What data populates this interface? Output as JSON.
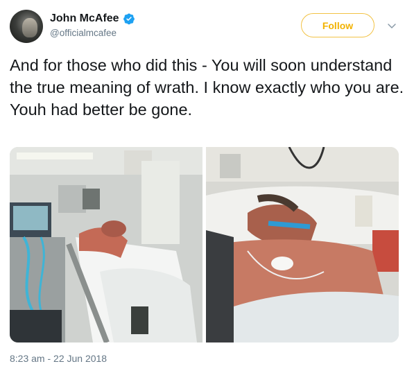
{
  "tweet": {
    "author": {
      "display_name": "John McAfee",
      "handle": "@officialmcafee",
      "verified": true,
      "avatar_icon": "avatar-photo"
    },
    "follow_label": "Follow",
    "text": "And for those who did this - You will soon understand the true meaning of wrath. I know exactly who you  are. Youh had better be gone.",
    "media": [
      {
        "kind": "photo",
        "subject": "hospital-bed-left"
      },
      {
        "kind": "photo",
        "subject": "hospital-bed-right"
      }
    ],
    "timestamp": "8:23 am - 22 Jun 2018"
  },
  "colors": {
    "follow_accent": "#f2b200",
    "verified_blue": "#1da1f2",
    "secondary_text": "#657786"
  }
}
